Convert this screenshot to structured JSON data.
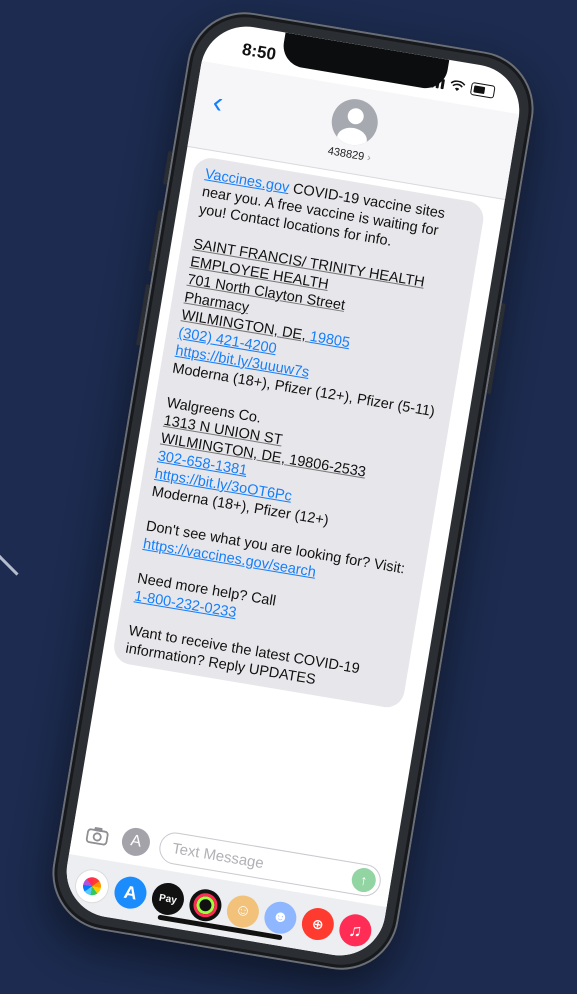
{
  "status_bar": {
    "time": "8:50"
  },
  "header": {
    "back_glyph": "‹",
    "contact_name": "438829",
    "contact_chevron": "›"
  },
  "messages": [
    {
      "paragraphs": [
        [
          [
            {
              "t": "Vaccines.gov",
              "style": "link"
            },
            {
              "t": " COVID-19 vaccine sites near you. A free vaccine is waiting for you! Contact locations for info.",
              "style": "plain"
            }
          ]
        ],
        [
          [
            {
              "t": "SAINT FRANCIS/ TRINITY HEALTH",
              "style": "underline"
            }
          ],
          [
            {
              "t": "EMPLOYEE HEALTH",
              "style": "underline"
            }
          ],
          [
            {
              "t": "701 North Clayton Street",
              "style": "underline"
            }
          ],
          [
            {
              "t": "Pharmacy",
              "style": "underline"
            }
          ],
          [
            {
              "t": "WILMINGTON, DE, ",
              "style": "underline"
            },
            {
              "t": "19805",
              "style": "link"
            }
          ],
          [
            {
              "t": "(302) 421-4200",
              "style": "link"
            }
          ],
          [
            {
              "t": "https://bit.ly/3uuuw7s",
              "style": "link"
            }
          ],
          [
            {
              "t": "Moderna (18+), Pfizer (12+), Pfizer (5-11)",
              "style": "plain"
            }
          ]
        ],
        [
          [
            {
              "t": "Walgreens Co.",
              "style": "plain"
            }
          ],
          [
            {
              "t": "1313 N UNION ST",
              "style": "underline"
            }
          ],
          [
            {
              "t": "WILMINGTON, DE, 19806-2533",
              "style": "underline"
            }
          ],
          [
            {
              "t": "302-658-1381",
              "style": "link"
            }
          ],
          [
            {
              "t": "https://bit.ly/3oOT6Pc",
              "style": "link"
            }
          ],
          [
            {
              "t": "Moderna (18+), Pfizer (12+)",
              "style": "plain"
            }
          ]
        ],
        [
          [
            {
              "t": "Don't see what you are looking for? Visit: ",
              "style": "plain"
            },
            {
              "t": "https://vaccines.gov/search",
              "style": "link"
            }
          ]
        ],
        [
          [
            {
              "t": "Need more help? Call",
              "style": "plain"
            }
          ],
          [
            {
              "t": "1-800-232-0233",
              "style": "link"
            }
          ]
        ],
        [
          [
            {
              "t": "Want to receive the latest COVID-19 information? Reply UPDATES",
              "style": "plain"
            }
          ]
        ]
      ]
    }
  ],
  "composer": {
    "placeholder": "Text Message",
    "send_glyph": "↑"
  },
  "app_drawer": [
    {
      "name": "photos-app-icon",
      "glyph": ""
    },
    {
      "name": "app-store-app-icon",
      "glyph": "A"
    },
    {
      "name": "apple-pay-app-icon",
      "glyph": "Pay"
    },
    {
      "name": "activity-app-icon",
      "glyph": ""
    },
    {
      "name": "memoji-app-icon",
      "glyph": "☺"
    },
    {
      "name": "memoji-stickers-app-icon",
      "glyph": "☻"
    },
    {
      "name": "images-search-app-icon",
      "glyph": "⊕"
    },
    {
      "name": "music-app-icon",
      "glyph": "♫"
    }
  ],
  "colors": {
    "background": "#1c2b4f",
    "ios_blue": "#147efb",
    "bubble_gray": "#e7e7eb",
    "send_green": "#93d4a3"
  }
}
